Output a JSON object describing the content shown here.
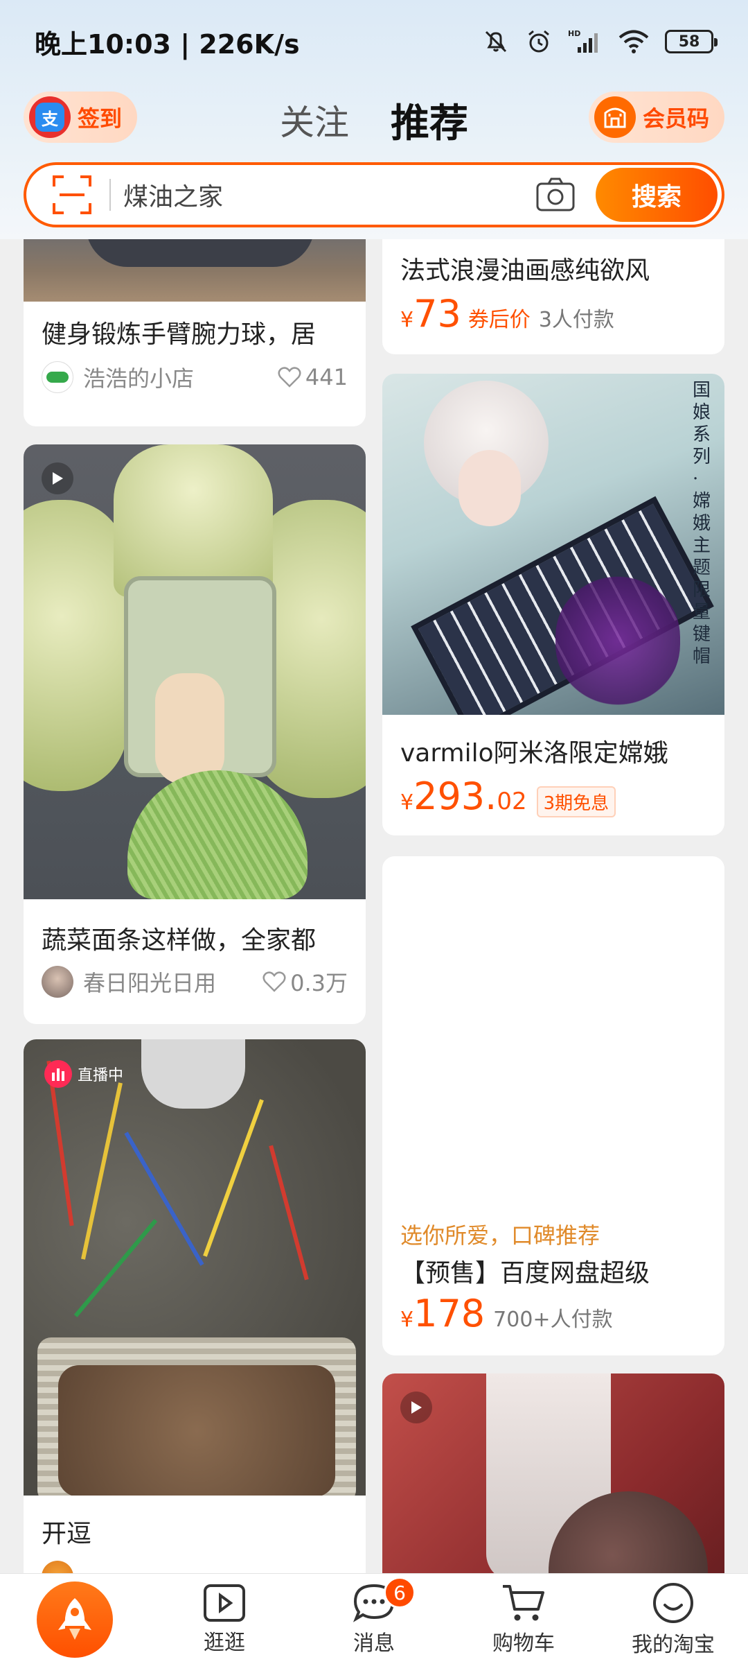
{
  "status_bar": {
    "time": "晚上10:03 | 226K/s",
    "battery": "58"
  },
  "header": {
    "checkin_label": "签到",
    "alipay_glyph": "支",
    "tabs": [
      {
        "label": "关注",
        "selected": false
      },
      {
        "label": "推荐",
        "selected": true
      }
    ],
    "member_code_label": "会员码"
  },
  "search": {
    "placeholder": "煤油之家",
    "button_label": "搜索"
  },
  "feed": {
    "left": [
      {
        "title": "健身锻炼手臂腕力球，居",
        "shop": "浩浩的小店",
        "likes": "441"
      },
      {
        "title": "蔬菜面条这样做，全家都",
        "shop": "春日阳光日用",
        "likes": "0.3万"
      },
      {
        "live_label": "直播中",
        "title": "开逗"
      }
    ],
    "right": [
      {
        "title": "法式浪漫油画感纯欲风",
        "yen": "¥",
        "price": "73",
        "price_note": "券后价",
        "sold": "3人付款"
      },
      {
        "image_text": "国娘系列·嫦娥 主题限量键帽",
        "title": "varmilo阿米洛限定嫦娥",
        "yen": "¥",
        "price_int": "293.",
        "price_dec": "02",
        "tag": "3期免息"
      },
      {
        "subtitle": "选你所爱，口碑推荐",
        "title": "【预售】百度网盘超级",
        "yen": "¥",
        "price": "178",
        "sold": "700+人付款"
      }
    ]
  },
  "bottom_nav": [
    {
      "label": ""
    },
    {
      "label": "逛逛"
    },
    {
      "label": "消息",
      "badge": "6"
    },
    {
      "label": "购物车"
    },
    {
      "label": "我的淘宝"
    }
  ],
  "colors": {
    "accent": "#ff5000",
    "background": "#efefef"
  }
}
